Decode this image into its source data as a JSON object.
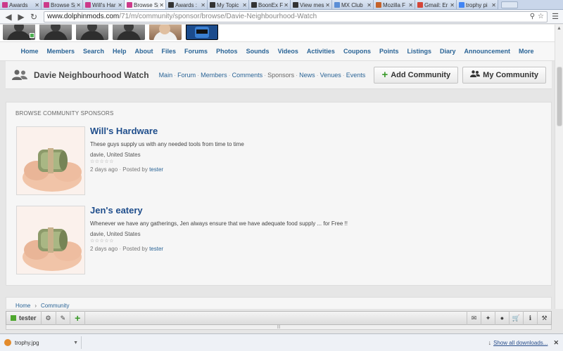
{
  "browser": {
    "tabs": [
      {
        "label": "Awards",
        "fav": "#cc3a8a",
        "active": false
      },
      {
        "label": "Browse Sp",
        "fav": "#cc3a8a",
        "active": false
      },
      {
        "label": "Will's Har",
        "fav": "#cc3a8a",
        "active": false
      },
      {
        "label": "Browse Sp",
        "fav": "#cc3a8a",
        "active": true
      },
      {
        "label": "Awards :",
        "fav": "#333333",
        "active": false
      },
      {
        "label": "My Topic",
        "fav": "#333333",
        "active": false
      },
      {
        "label": "BoonEx F",
        "fav": "#333333",
        "active": false
      },
      {
        "label": "View mes",
        "fav": "#333333",
        "active": false
      },
      {
        "label": "MX Club",
        "fav": "#5b8ed6",
        "active": false
      },
      {
        "label": "Mozilla F",
        "fav": "#c4622a",
        "active": false
      },
      {
        "label": "Gmail: Er",
        "fav": "#d44638",
        "active": false
      },
      {
        "label": "trophy pi",
        "fav": "#4285f4",
        "active": false
      }
    ],
    "url_host": "www.dolphinmods.com",
    "url_path": "/71/m/community/sponsor/browse/Davie-Neighbourhood-Watch",
    "download": {
      "filename": "trophy.jpg",
      "show_all": "Show all downloads..."
    }
  },
  "site": {
    "nav": [
      "Home",
      "Members",
      "Search",
      "Help",
      "About",
      "Files",
      "Forums",
      "Photos",
      "Sounds",
      "Videos",
      "Activities",
      "Coupons",
      "Points",
      "Listings",
      "Diary",
      "Announcement",
      "More"
    ],
    "community": {
      "title": "Davie Neighbourhood Watch",
      "subnav": [
        "Main",
        "Forum",
        "Members",
        "Comments",
        "Sponsors",
        "News",
        "Venues",
        "Events"
      ],
      "current_subnav": "Sponsors",
      "add_button": "Add Community",
      "my_button": "My Community"
    },
    "section_title": "BROWSE COMMUNITY SPONSORS",
    "sponsors": [
      {
        "name": "Will's Hardware",
        "description": "These guys supply us with any needed tools from time to time",
        "location": "davie, United States",
        "stars": "☆☆☆☆☆",
        "time": "2 days ago",
        "posted_by_label": "Posted by",
        "author": "tester"
      },
      {
        "name": "Jen's eatery",
        "description": "Whenever we have any gatherings, Jen always ensure that we have adequate food supply ... for Free !!",
        "location": "davie, United States",
        "stars": "☆☆☆☆☆",
        "time": "2 days ago",
        "posted_by_label": "Posted by",
        "author": "tester"
      }
    ],
    "breadcrumb": [
      "Home",
      "Community"
    ],
    "toolbar": {
      "username": "tester"
    }
  }
}
